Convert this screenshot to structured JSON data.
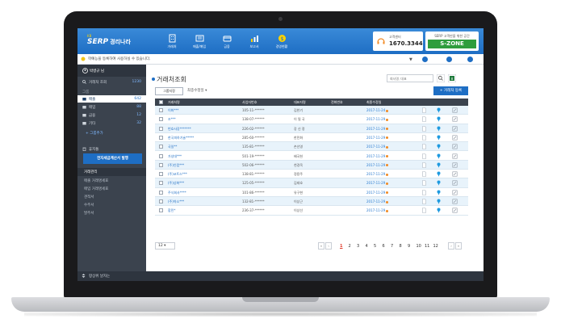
{
  "header": {
    "logo_kb": "KB",
    "logo_main": "SERP",
    "logo_sub": "경리나라",
    "nav": [
      {
        "label": "거래처",
        "icon": "building-icon"
      },
      {
        "label": "매출/매입",
        "icon": "invoice-icon"
      },
      {
        "label": "금융",
        "icon": "card-icon"
      },
      {
        "label": "보고서",
        "icon": "chart-icon"
      },
      {
        "label": "경영현황",
        "icon": "coin-icon"
      }
    ],
    "call_label": "고객센터",
    "call_number": "1670.3344",
    "szone_sub": "SERP 고객만을 위한 공간",
    "szone_main": "S-ZONE"
  },
  "notice": {
    "text": "학예능을 등록하여 사용하실 수 있습니다."
  },
  "sidebar": {
    "user_name": "박병규 님",
    "items": [
      {
        "label": "거래처 조회",
        "count": "1230",
        "icon": "search-icon"
      },
      {
        "label": "매출",
        "count": "642",
        "icon": "folder-icon",
        "active": true
      },
      {
        "label": "매입",
        "count": "88",
        "icon": "folder-icon"
      },
      {
        "label": "금융",
        "count": "12",
        "icon": "folder-icon"
      },
      {
        "label": "기타",
        "count": "32",
        "icon": "folder-icon"
      }
    ],
    "group_label": "그룹",
    "group_add": "+ 그룹추가",
    "trash_label": "휴지통",
    "blue_button": "전자세금계산서 발행",
    "section_title": "거래관리",
    "links": [
      "매출 거래명세표",
      "매입 거래명세표",
      "견적서",
      "수주서",
      "발주서"
    ],
    "bottom_text": "항상위 날자는"
  },
  "content": {
    "title": "거래처조회",
    "search_placeholder": "회사명, 대표",
    "group_button": "그룹지정",
    "sort_label": "최종수정일",
    "add_button": "+ 거래처 등록",
    "columns": [
      "거래처명",
      "사업자번호",
      "대표자명",
      "전화번호",
      "최종수정일"
    ],
    "rows": [
      {
        "name": "이화***",
        "biz": "105-11-******",
        "ceo": "김한기",
        "date": "2017-11-24"
      },
      {
        "name": "조***",
        "biz": "138-07-******",
        "ceo": "이 필 국",
        "date": "2017-11-29"
      },
      {
        "name": "번호사강*******",
        "biz": "226-02-******",
        "ceo": "강 신 정",
        "date": "2017-11-29"
      },
      {
        "name": "한국피하기술*****",
        "biz": "285-60-******",
        "ceo": "한민화",
        "date": "2017-11-29"
      },
      {
        "name": "국일**",
        "biz": "135-81-******",
        "ceo": "손선영",
        "date": "2017-11-29"
      },
      {
        "name": "가성대***",
        "biz": "501-19-******",
        "ceo": "배국헌",
        "date": "2017-11-29"
      },
      {
        "name": "(주)인컴***",
        "biz": "502-06-******",
        "ceo": "천경옥",
        "date": "2017-11-29"
      },
      {
        "name": "(주)코트스***",
        "biz": "138-81-******",
        "ceo": "정용주",
        "date": "2017-11-29"
      },
      {
        "name": "(주)상화***",
        "biz": "125-05-******",
        "ceo": "김태호",
        "date": "2017-11-29"
      },
      {
        "name": "주식회사****",
        "biz": "101-86-******",
        "ceo": "유구현",
        "date": "2017-11-29"
      },
      {
        "name": "(주)약소***",
        "biz": "132-81-******",
        "ceo": "이상근",
        "date": "2017-11-29"
      },
      {
        "name": "합민*",
        "biz": "236-37-******",
        "ceo": "이상선",
        "date": "2017-11-29"
      }
    ],
    "page_size": "12",
    "pages": [
      "1",
      "2",
      "3",
      "4",
      "5",
      "6",
      "7",
      "8",
      "9",
      "10",
      "11",
      "12"
    ],
    "current_page": "1"
  },
  "colors": {
    "brand_blue": "#1e6ec4",
    "sidebar_dark": "#3b434e",
    "szone_green": "#2e9d3d",
    "accent_orange": "#f08a24"
  }
}
